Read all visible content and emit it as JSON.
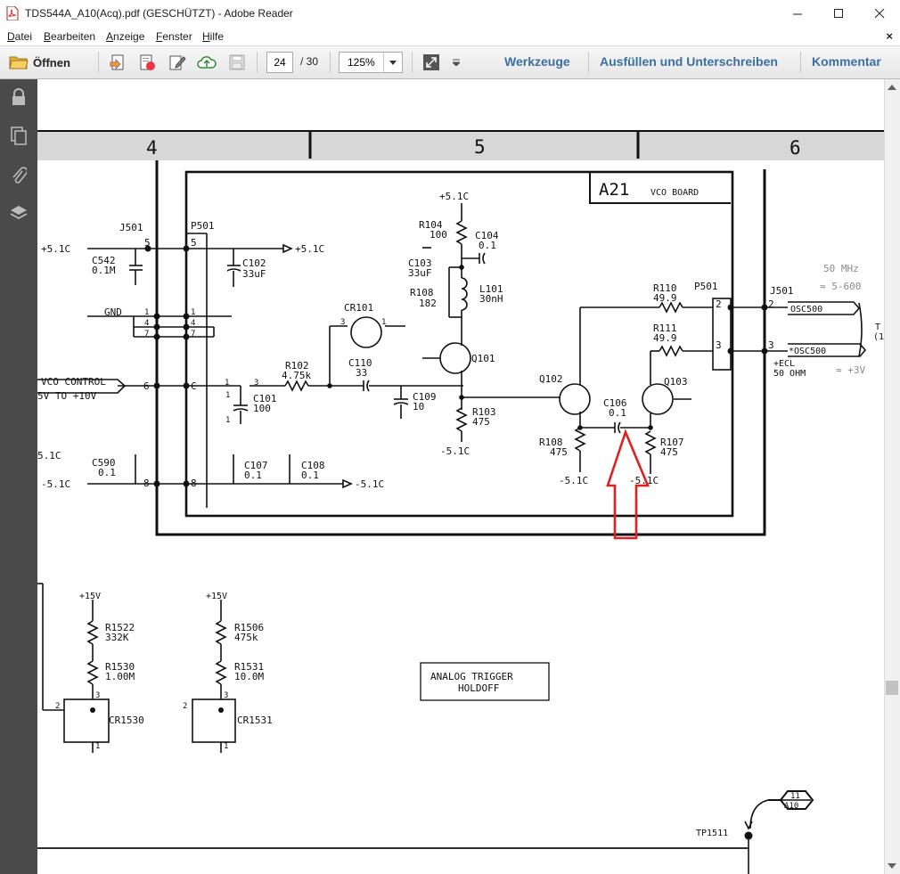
{
  "window": {
    "title": "TDS544A_A10(Acq).pdf (GESCHÜTZT) - Adobe Reader"
  },
  "menu": [
    {
      "first": "D",
      "rest": "atei"
    },
    {
      "first": "B",
      "rest": "earbeiten"
    },
    {
      "first": "A",
      "rest": "nzeige"
    },
    {
      "first": "F",
      "rest": "enster"
    },
    {
      "first": "H",
      "rest": "ilfe"
    }
  ],
  "toolbar": {
    "open_label": "Öffnen",
    "page_current": "24",
    "page_total": "/ 30",
    "zoom": "125%",
    "tools_label": "Werkzeuge",
    "fill_sign_label": "Ausfüllen und Unterschreiben",
    "comment_label": "Kommentar"
  },
  "icons": {
    "open": "folder-icon",
    "save": "save-icon",
    "lock": "lock-icon",
    "pages": "pages-icon",
    "attach": "paperclip-icon",
    "layers": "layers-icon"
  },
  "colors": {
    "panel_link": "#3b6ea5",
    "sidebar": "#4a4a4a",
    "annotation_arrow": "#e02020"
  },
  "schematic": {
    "zones": [
      "4",
      "5",
      "6"
    ],
    "board_title": "A21",
    "board_subtitle": "VCO BOARD",
    "connectors": {
      "j501": "J501",
      "p501": "P501",
      "p501_right": "P501",
      "j501_right": "J501"
    },
    "pins": [
      "5",
      "5",
      "1",
      "4",
      "7",
      "1",
      "4",
      "7",
      "6",
      "C",
      "8",
      "8",
      "2",
      "2",
      "3",
      "3",
      "1",
      "3",
      "1",
      "3",
      "2",
      "1",
      "3",
      "2",
      "1",
      "3",
      "1",
      "1"
    ],
    "nets": {
      "v51_left": "+5.1C",
      "v51_right": "+5.1C",
      "v51_top": "+5.1C",
      "v51_far_left": "5.1C",
      "vm51_left": "-5.1C",
      "vm51_right": "-5.1C",
      "vm51_r103": "-5.1C",
      "vm51_r108": "-5.1C",
      "vm51_r107": "-5.1C",
      "gnd": "GND",
      "vco_control": "VCO CONTROL",
      "vco_range": "5V TO +10V",
      "p15_a": "+15V",
      "p15_b": "+15V",
      "osc": "OSC500",
      "osc_n": "*OSC500",
      "ecl": "+ECL",
      "ohm": "50 OHM",
      "tp": "TP1511"
    },
    "parts": {
      "c542": [
        "C542",
        "0.1M"
      ],
      "c102": [
        "C102",
        "33uF"
      ],
      "c590": [
        "C590",
        "0.1"
      ],
      "c101": [
        "C101",
        "100"
      ],
      "r102": [
        "R102",
        "4.75k"
      ],
      "c110": [
        "C110",
        "33"
      ],
      "c109": [
        "C109",
        "10"
      ],
      "c107": [
        "C107",
        "0.1"
      ],
      "c108": [
        "C108",
        "0.1"
      ],
      "cr101": [
        "CR101"
      ],
      "r104": [
        "R104",
        "100"
      ],
      "c104": [
        "C104",
        "0.1"
      ],
      "c103": [
        "C103",
        "33uF"
      ],
      "r108a": [
        "R108",
        "182"
      ],
      "l101": [
        "L101",
        "30nH"
      ],
      "q101": [
        "Q101"
      ],
      "r103": [
        "R103",
        "475"
      ],
      "q102": [
        "Q102"
      ],
      "q103": [
        "Q103"
      ],
      "c106": [
        "C106",
        "0.1"
      ],
      "r108b": [
        "R108",
        "475"
      ],
      "r107": [
        "R107",
        "475"
      ],
      "r110": [
        "R110",
        "49.9"
      ],
      "r111": [
        "R111",
        "49.9"
      ],
      "r1522": [
        "R1522",
        "332K"
      ],
      "r1530": [
        "R1530",
        "1.00M"
      ],
      "r1506": [
        "R1506",
        "475k"
      ],
      "r1531": [
        "R1531",
        "10.0M"
      ],
      "cr1530": [
        "CR1530"
      ],
      "cr1531": [
        "CR1531"
      ]
    },
    "analog_box": [
      "ANALOG TRIGGER",
      "HOLDOFF"
    ],
    "sheet_ref": [
      "11",
      "A10"
    ],
    "handwritten": [
      "50 MHz",
      "≈ 5-600",
      "≈ +3V"
    ],
    "cut_labels": [
      "T",
      "(1"
    ]
  }
}
